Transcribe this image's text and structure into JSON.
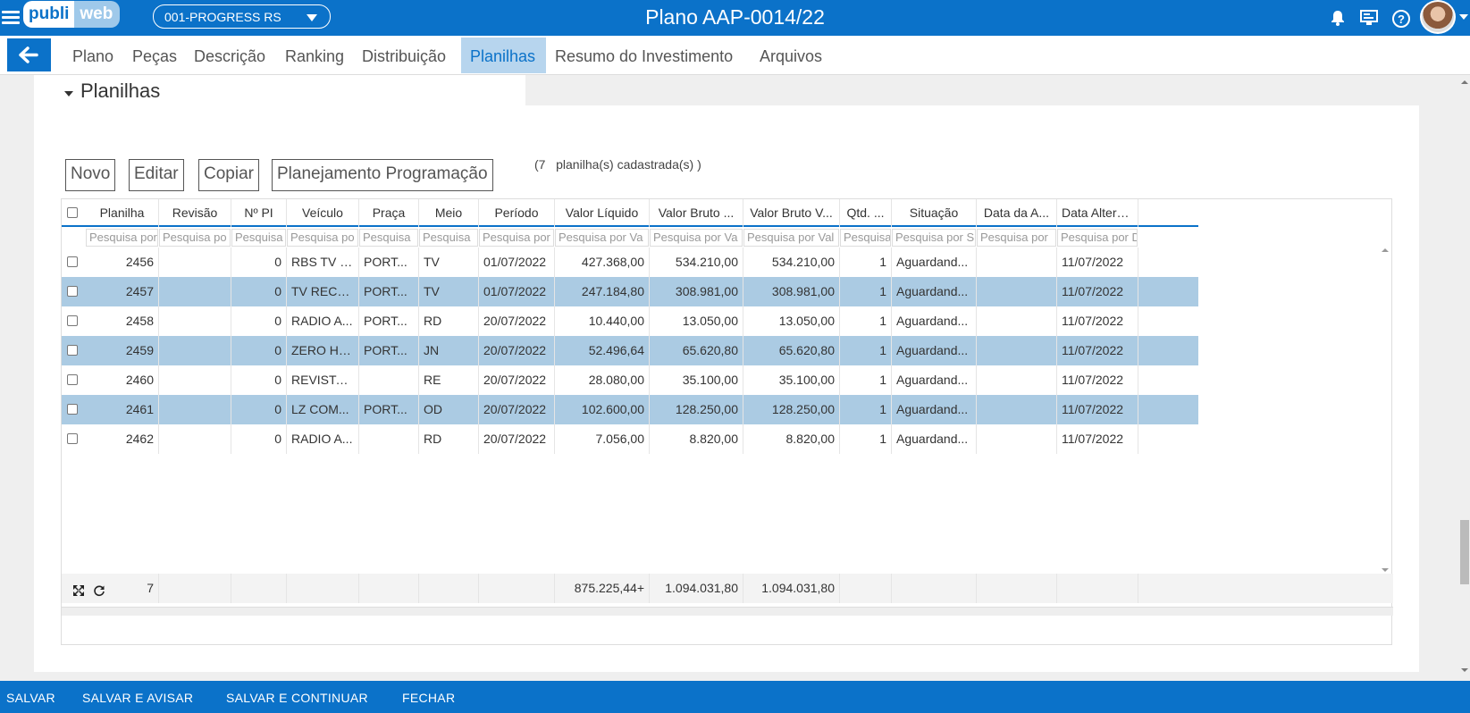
{
  "header": {
    "logo_part1": "publi",
    "logo_part2": "web",
    "client_select": "001-PROGRESS RS",
    "title": "Plano AAP-0014/22",
    "icons": [
      "menu-icon",
      "bell-icon",
      "monitor-icon",
      "help-icon",
      "avatar"
    ]
  },
  "tabs": [
    {
      "label": "Plano"
    },
    {
      "label": "Peças"
    },
    {
      "label": "Descrição"
    },
    {
      "label": "Ranking"
    },
    {
      "label": "Distribuição"
    },
    {
      "label": "Planilhas",
      "active": true
    },
    {
      "label": "Resumo do Investimento"
    },
    {
      "label": "Arquivos"
    }
  ],
  "section": {
    "title": "Planilhas",
    "buttons": {
      "novo": "Novo",
      "editar": "Editar",
      "copiar": "Copiar",
      "planejamento": "Planejamento Programação"
    },
    "count_prefix": "(7",
    "count_suffix": "planilha(s) cadastrada(s) )"
  },
  "grid": {
    "columns": [
      "Planilha",
      "Revisão",
      "Nº PI",
      "Veículo",
      "Praça",
      "Meio",
      "Período",
      "Valor Líquido",
      "Valor Bruto ...",
      "Valor Bruto V...",
      "Qtd. ...",
      "Situação",
      "Data da A...",
      "Data Altera..."
    ],
    "filters": [
      "Pesquisa por",
      "Pesquisa po",
      "Pesquisa",
      "Pesquisa po",
      "Pesquisa",
      "Pesquisa",
      "Pesquisa por",
      "Pesquisa por Va",
      "Pesquisa por Va",
      "Pesquisa por Val",
      "Pesquisa",
      "Pesquisa por S",
      "Pesquisa por",
      "Pesquisa por D"
    ],
    "rows": [
      [
        "2456",
        "",
        "0",
        "RBS TV P...",
        "PORT...",
        "TV",
        "01/07/2022",
        "427.368,00",
        "534.210,00",
        "534.210,00",
        "1",
        "Aguardand...",
        "",
        "11/07/2022"
      ],
      [
        "2457",
        "",
        "0",
        "TV RECO...",
        "PORT...",
        "TV",
        "01/07/2022",
        "247.184,80",
        "308.981,00",
        "308.981,00",
        "1",
        "Aguardand...",
        "",
        "11/07/2022"
      ],
      [
        "2458",
        "",
        "0",
        "RADIO A...",
        "PORT...",
        "RD",
        "20/07/2022",
        "10.440,00",
        "13.050,00",
        "13.050,00",
        "1",
        "Aguardand...",
        "",
        "11/07/2022"
      ],
      [
        "2459",
        "",
        "0",
        "ZERO HO...",
        "PORT...",
        "JN",
        "20/07/2022",
        "52.496,64",
        "65.620,80",
        "65.620,80",
        "1",
        "Aguardand...",
        "",
        "11/07/2022"
      ],
      [
        "2460",
        "",
        "0",
        "REVISTA ...",
        "",
        "RE",
        "20/07/2022",
        "28.080,00",
        "35.100,00",
        "35.100,00",
        "1",
        "Aguardand...",
        "",
        "11/07/2022"
      ],
      [
        "2461",
        "",
        "0",
        "LZ COM...",
        "PORT...",
        "OD",
        "20/07/2022",
        "102.600,00",
        "128.250,00",
        "128.250,00",
        "1",
        "Aguardand...",
        "",
        "11/07/2022"
      ],
      [
        "2462",
        "",
        "0",
        "RADIO A...",
        "",
        "RD",
        "20/07/2022",
        "7.056,00",
        "8.820,00",
        "8.820,00",
        "1",
        "Aguardand...",
        "",
        "11/07/2022"
      ]
    ],
    "footer": [
      "7",
      "",
      "",
      "",
      "",
      "",
      "",
      "875.225,44+",
      "1.094.031,80",
      "1.094.031,80",
      "",
      "",
      "",
      ""
    ]
  },
  "bottom_actions": [
    "SALVAR",
    "SALVAR E AVISAR",
    "SALVAR E CONTINUAR",
    "FECHAR"
  ],
  "colors": {
    "primary": "#0b72c9",
    "row_alt": "#abcbe3",
    "tab_active_bg": "#b7d5ee"
  }
}
